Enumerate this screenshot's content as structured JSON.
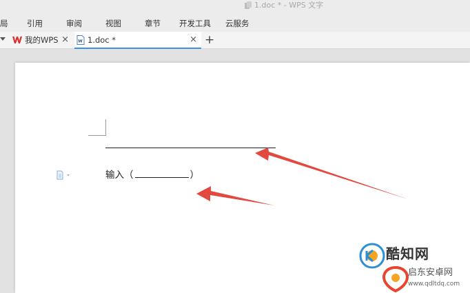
{
  "window": {
    "title": "1.doc * - WPS 文字"
  },
  "menu": {
    "items": [
      "局",
      "引用",
      "审阅",
      "视图",
      "章节",
      "开发工具",
      "云服务"
    ]
  },
  "tabs": {
    "items": [
      {
        "label": "我的WPS",
        "close": "×"
      },
      {
        "label": "1.doc *",
        "close": "×"
      }
    ],
    "new_tab": "+"
  },
  "document": {
    "input_prefix": "输入（",
    "input_suffix": "）"
  },
  "watermark": {
    "main": "酷知网",
    "sub": "启东安卓网",
    "url": "www.qdltdq.com"
  },
  "colors": {
    "accent": "#3d8fe0",
    "annotation_arrow": "#e03a2f",
    "wps_red": "#d9302c"
  }
}
